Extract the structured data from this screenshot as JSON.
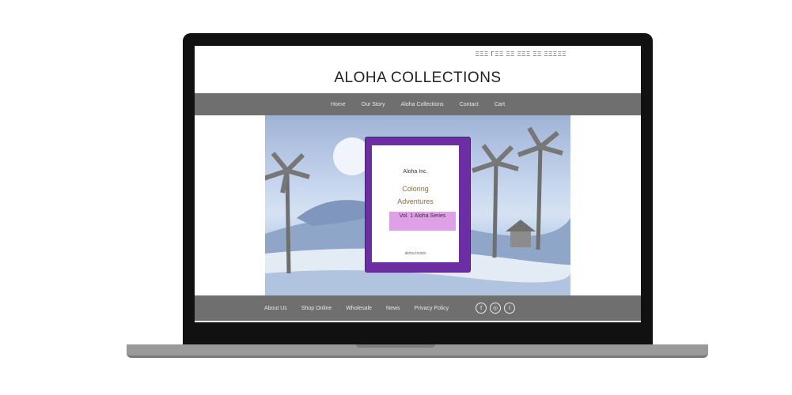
{
  "site": {
    "topbar": "ΞΞΞ ΓΞΞ ΞΞ ΞΞΞ ΞΞ  ΞΞΞΞΞ",
    "title": "ALOHA COLLECTIONS",
    "nav": [
      "Home",
      "Our Story",
      "Aloha Collections",
      "Contact",
      "Cart"
    ]
  },
  "book": {
    "author": "Aloha Inc.",
    "title_line1": "Coloring",
    "title_line2": "Adventures",
    "label": "Vol. 1 Aloha Series",
    "foot": "aloha books"
  },
  "footer": {
    "links": [
      "About Us",
      "Shop Online",
      "Wholesale",
      "News",
      "Privacy Policy"
    ],
    "socials": [
      {
        "icon": "facebook-icon",
        "glyph": "f"
      },
      {
        "icon": "instagram-icon",
        "glyph": "◎"
      },
      {
        "icon": "twitter-icon",
        "glyph": "t"
      }
    ]
  },
  "colors": {
    "bezel": "#111111",
    "nav_bg": "#6f6f6f",
    "book_purple": "#6b2fa3",
    "book_label": "#dfa0e8"
  }
}
